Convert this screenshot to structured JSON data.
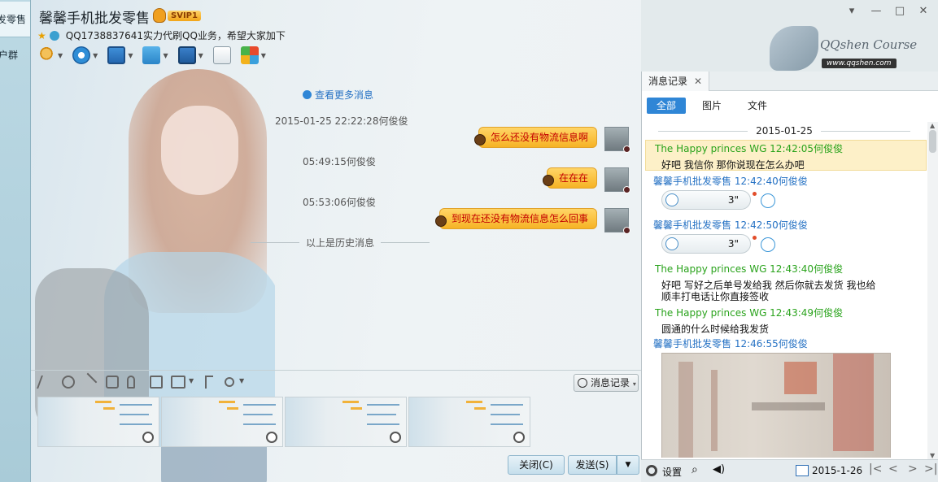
{
  "sidebar": {
    "tabs": [
      {
        "label": "发零售"
      },
      {
        "label": "户群"
      }
    ]
  },
  "header": {
    "title": "馨馨手机批发零售",
    "vip_badge": "SVIP1",
    "signature": "QQ1738837641实力代刷QQ业务，希望大家加下"
  },
  "toolbar": {
    "icons": [
      "microphone-icon",
      "camera-icon",
      "screen-share-icon",
      "file-transfer-icon",
      "remote-desktop-icon",
      "add-app-icon",
      "apps-grid-icon"
    ]
  },
  "chat": {
    "more_messages": "查看更多消息",
    "history_label": "以上是历史消息",
    "messages": [
      {
        "timestamp": "2015-01-25 22:22:28何俊俊",
        "text": "怎么还没有物流信息啊"
      },
      {
        "timestamp": "05:49:15何俊俊",
        "text": "在在在"
      },
      {
        "timestamp": "05:53:06何俊俊",
        "text": "到现在还没有物流信息怎么回事"
      }
    ]
  },
  "input_toolbar": {
    "message_record_label": "消息记录"
  },
  "buttons": {
    "close": "关闭(C)",
    "send": "发送(S)"
  },
  "window_controls": {
    "menu": "▾",
    "minimize": "—",
    "maximize": "□",
    "close": "✕"
  },
  "logo": {
    "name": "QQshen Course",
    "url": "www.qqshen.com"
  },
  "right_panel": {
    "tab_title": "消息记录",
    "tab_close": "✕",
    "filters": [
      {
        "label": "全部"
      },
      {
        "label": "图片"
      },
      {
        "label": "文件"
      }
    ],
    "date": "2015-01-25",
    "entries": [
      {
        "header": "The Happy princes  WG 12:42:05何俊俊",
        "text": "好吧   我信你    那你说现在怎么办吧"
      },
      {
        "header": "馨馨手机批发零售 12:42:40何俊俊",
        "voice": "3\""
      },
      {
        "header": "馨馨手机批发零售 12:42:50何俊俊",
        "voice": "3\""
      },
      {
        "header": "The Happy princes  WG 12:43:40何俊俊",
        "text": "好吧  写好之后单号发给我    然后你就去发货          我也给",
        "text2": "顺丰打电话让你直接签收"
      },
      {
        "header": "The Happy princes  WG 12:43:49何俊俊",
        "text": "圆通的什么时候给我发货"
      },
      {
        "header": "馨馨手机批发零售 12:46:55何俊俊"
      }
    ],
    "footer": {
      "settings_label": "设置",
      "date": "2015-1-26"
    }
  }
}
